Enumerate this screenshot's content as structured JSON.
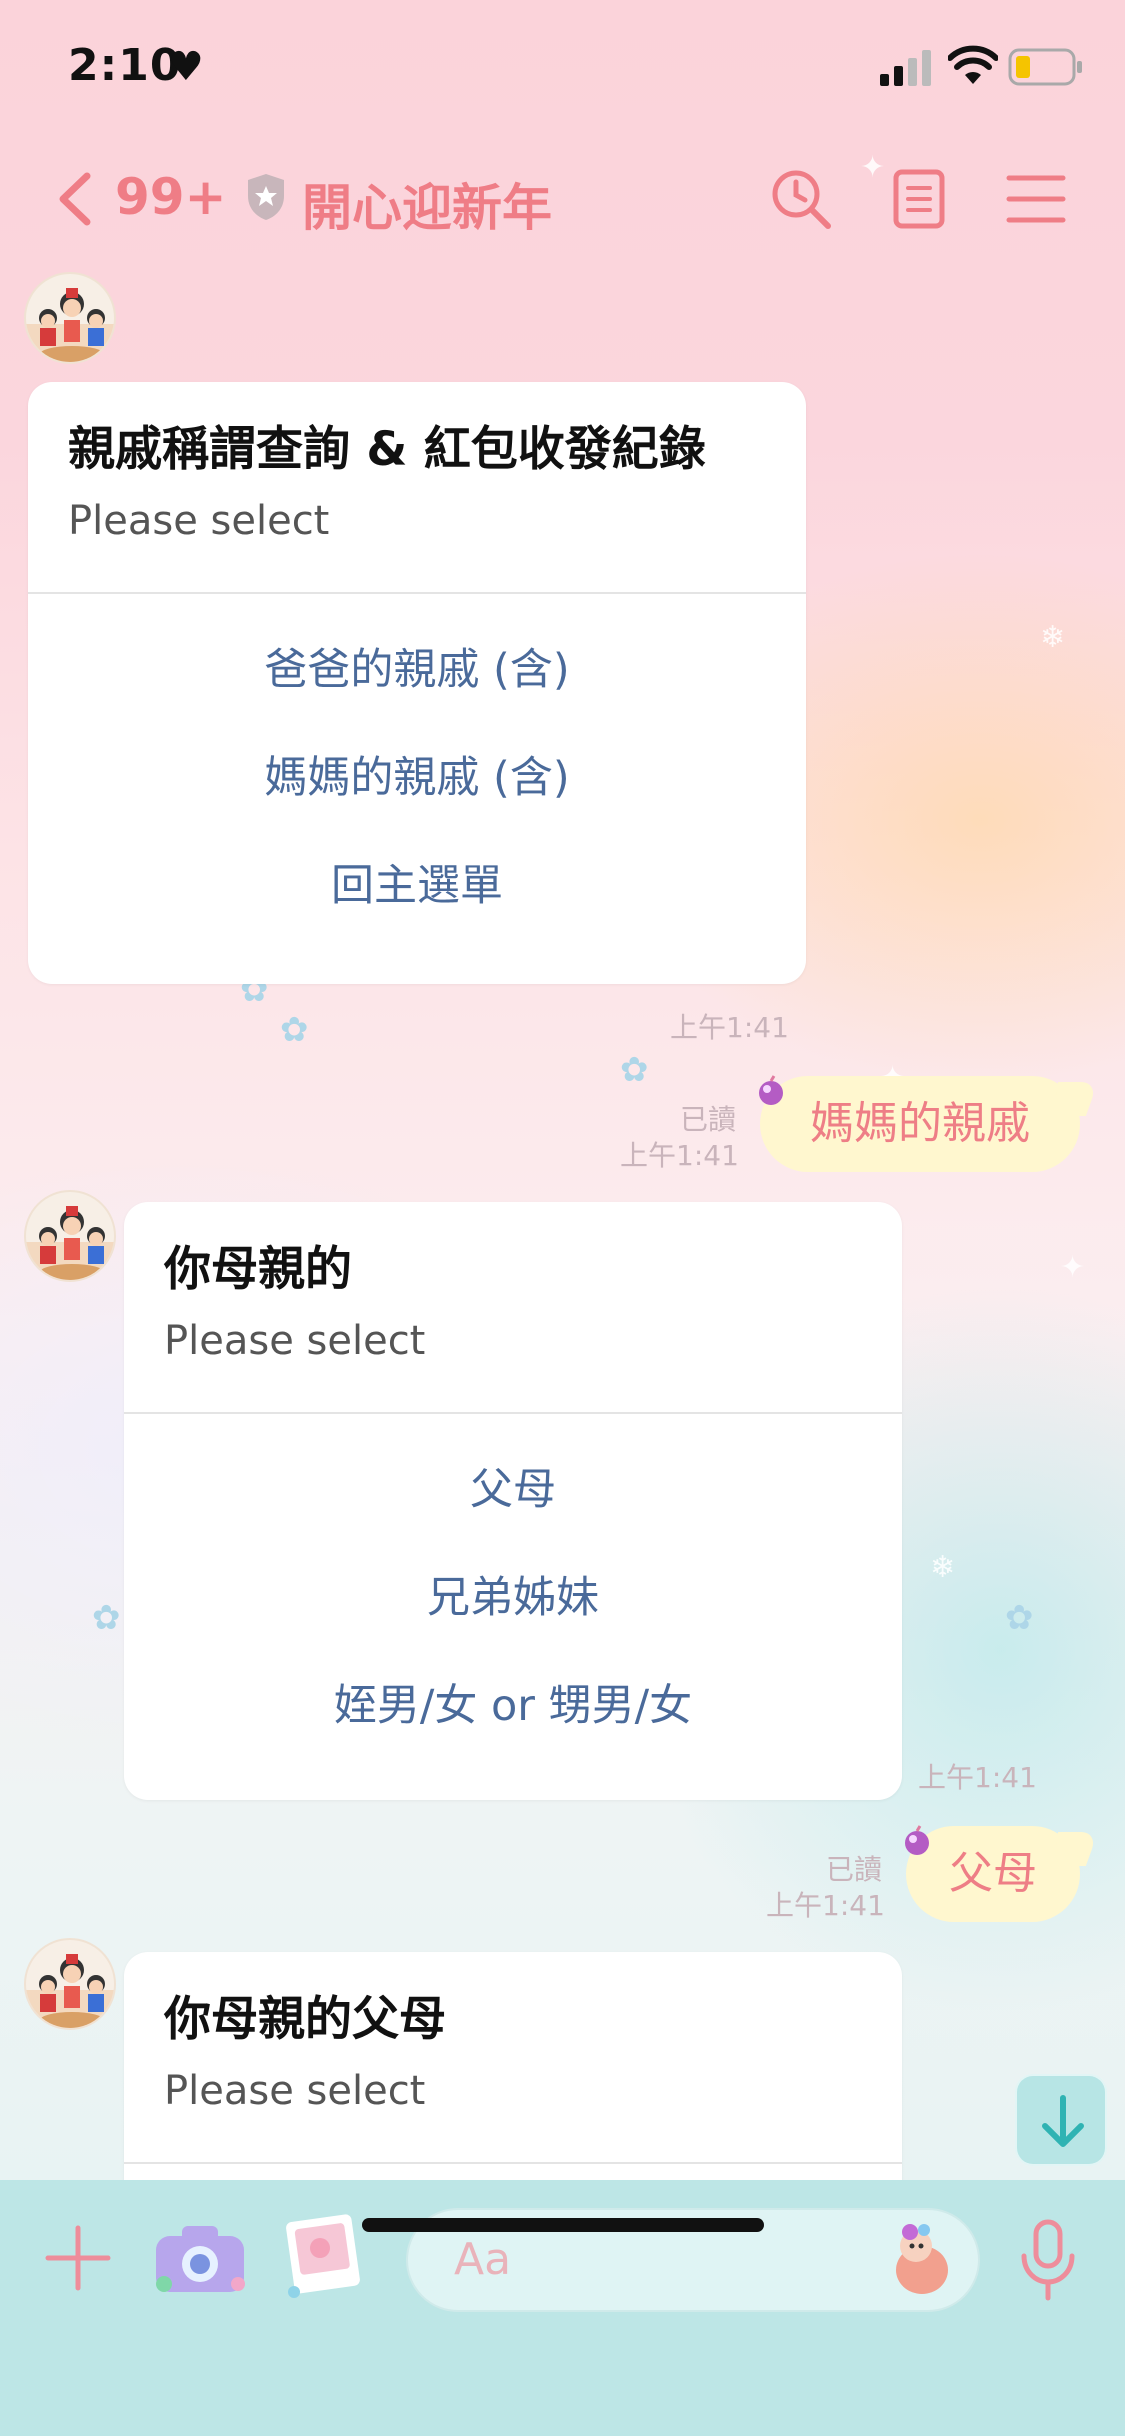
{
  "status_bar": {
    "time": "2:10"
  },
  "header": {
    "unread_count": "99+",
    "chat_title": "開心迎新年"
  },
  "messages": {
    "card1": {
      "title": "親戚稱謂查詢 & 紅包收發紀錄",
      "subtitle": "Please select",
      "options": [
        "爸爸的親戚 (含)",
        "媽媽的親戚 (含)",
        "回主選單"
      ],
      "time": "上午1:41"
    },
    "reply1": {
      "text": "媽媽的親戚",
      "read": "已讀",
      "time": "上午1:41"
    },
    "card2": {
      "title": "你母親的",
      "subtitle": "Please select",
      "options": [
        "父母",
        "兄弟姊妹",
        "姪男/女 or 甥男/女"
      ],
      "time": "上午1:41"
    },
    "reply2": {
      "text": "父母",
      "read": "已讀",
      "time": "上午1:41"
    },
    "card3": {
      "title": "你母親的父母",
      "subtitle": "Please select"
    }
  },
  "input_bar": {
    "placeholder": "Aa"
  },
  "colors": {
    "accent": "#ef7d86",
    "option_text": "#4a6a9a",
    "bubble": "#fff7cf",
    "input_bar": "#bde6e6"
  },
  "icons": [
    "heart-icon",
    "signal-icon",
    "wifi-icon",
    "battery-icon",
    "back-chevron-icon",
    "shield-icon",
    "search-icon",
    "notes-icon",
    "menu-icon",
    "arrow-down-icon",
    "plus-icon",
    "camera-icon",
    "photo-icon",
    "emoji-icon",
    "mic-icon"
  ]
}
